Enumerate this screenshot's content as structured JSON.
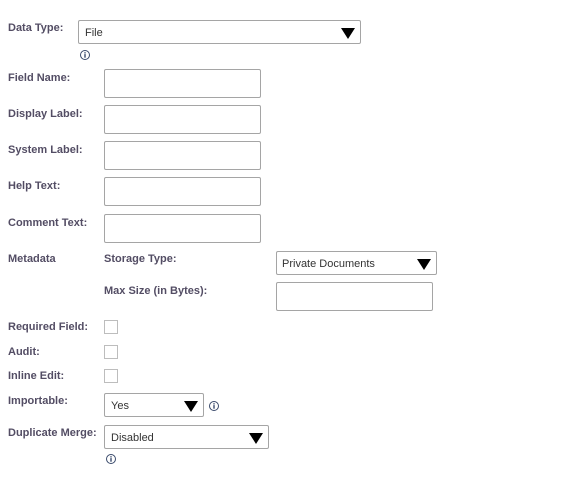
{
  "fields": {
    "data_type": {
      "label": "Data Type:",
      "value": "File"
    },
    "field_name": {
      "label": "Field Name:",
      "value": ""
    },
    "display_label": {
      "label": "Display Label:",
      "value": ""
    },
    "system_label": {
      "label": "System Label:",
      "value": ""
    },
    "help_text": {
      "label": "Help Text:",
      "value": ""
    },
    "comment_text": {
      "label": "Comment Text:",
      "value": ""
    },
    "metadata": {
      "label": "Metadata",
      "storage_type": {
        "label": "Storage Type:",
        "value": "Private Documents"
      },
      "max_size": {
        "label": "Max Size (in Bytes):",
        "value": ""
      }
    },
    "required_field": {
      "label": "Required Field:",
      "checked": false
    },
    "audit": {
      "label": "Audit:",
      "checked": false
    },
    "inline_edit": {
      "label": "Inline Edit:",
      "checked": false
    },
    "importable": {
      "label": "Importable:",
      "value": "Yes"
    },
    "duplicate_merge": {
      "label": "Duplicate Merge:",
      "value": "Disabled"
    }
  },
  "icons": {
    "info": "info-icon",
    "dropdown": "triangle-down-icon"
  },
  "colors": {
    "label": "#534d64",
    "border": "#a5a5a5",
    "info_icon": "#3a4a6b"
  }
}
